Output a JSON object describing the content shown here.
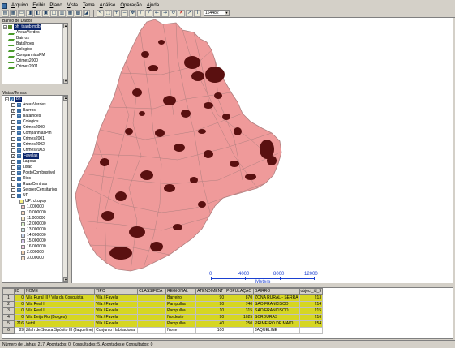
{
  "menu": {
    "items": [
      "Arquivo",
      "Exibir",
      "Plano",
      "Vista",
      "Tema",
      "Análise",
      "Operação",
      "Ajuda"
    ]
  },
  "toolbar": {
    "icons": [
      "open-database-icon",
      "open-layer-icon",
      "print-icon",
      "import-icon",
      "query-icon",
      "theme-icon",
      "layer-icon",
      "graph-icon",
      "table-icon",
      "grid-icon",
      "info-icon"
    ],
    "tools": [
      "pointer-icon",
      "zoom-area-icon",
      "zoom-in-icon",
      "zoom-out-icon",
      "pan-icon",
      "draw-icon",
      "ruler-icon",
      "arrow-left-icon",
      "arrow-right-icon",
      "refresh-icon",
      "delete-icon",
      "cursor-icon",
      "info-tool-icon"
    ],
    "scale_value": "164482"
  },
  "databases": {
    "title": "Banco de Dados",
    "root": "bh_tcaub.mdb",
    "layers": [
      "AreasVerdes",
      "Bairros",
      "Batalhoes",
      "Colegios",
      "CompanhiasPM",
      "Crimes2000",
      "Crimes2001"
    ]
  },
  "views": {
    "title": "Vistas/Temas",
    "root": "bh",
    "themes": [
      {
        "label": "AreasVerdes",
        "checked": false,
        "selected": false
      },
      {
        "label": "Bairros",
        "checked": true,
        "selected": false
      },
      {
        "label": "Batalhoes",
        "checked": false,
        "selected": false
      },
      {
        "label": "Colegios",
        "checked": false,
        "selected": false
      },
      {
        "label": "Crimes2000",
        "checked": false,
        "selected": false
      },
      {
        "label": "CompanhiasPm",
        "checked": false,
        "selected": false
      },
      {
        "label": "Crimes2001",
        "checked": false,
        "selected": false
      },
      {
        "label": "Crimes2002",
        "checked": false,
        "selected": false
      },
      {
        "label": "Crimes2003",
        "checked": false,
        "selected": false
      },
      {
        "label": "Favelas",
        "checked": true,
        "selected": true
      },
      {
        "label": "Lagoas",
        "checked": false,
        "selected": false
      },
      {
        "label": "Lixão",
        "checked": false,
        "selected": false
      },
      {
        "label": "PostoCombustivel",
        "checked": false,
        "selected": false
      },
      {
        "label": "Rios",
        "checked": false,
        "selected": false
      },
      {
        "label": "RuasCentrais",
        "checked": false,
        "selected": false
      },
      {
        "label": "SetoresCensitarios",
        "checked": false,
        "selected": false
      },
      {
        "label": "UP",
        "checked": false,
        "selected": false
      }
    ],
    "legend_title": "UP: ct.upop",
    "legend": [
      {
        "label": "1.000000",
        "color": "#f4c4c4"
      },
      {
        "label": "10.000000",
        "color": "#f8d8c0"
      },
      {
        "label": "11.000000",
        "color": "#fcecc8"
      },
      {
        "label": "12.000000",
        "color": "#d8f0c8"
      },
      {
        "label": "13.000000",
        "color": "#c8e8e8"
      },
      {
        "label": "14.000000",
        "color": "#c8d8f0"
      },
      {
        "label": "15.000000",
        "color": "#d8c8f0"
      },
      {
        "label": "16.000000",
        "color": "#f0c8e8"
      },
      {
        "label": "2.000000",
        "color": "#f0d0b0"
      },
      {
        "label": "3.000000",
        "color": "#f8e0c8"
      }
    ]
  },
  "map": {
    "fill_color": "#ef9a9a",
    "stroke_color": "#b08080",
    "favela_color": "#5a1010",
    "scale": {
      "ticks": [
        "0",
        "4000",
        "8000",
        "12000"
      ],
      "unit": "Meters",
      "color": "#1a3fd0"
    }
  },
  "table": {
    "columns": [
      "ID",
      "NOME",
      "TIPO",
      "CLASSIFICA",
      "REGIONAL",
      "ATENDIMENT",
      "POPULAÇÃO",
      "BAIRRO",
      "object_id_9"
    ],
    "rows": [
      {
        "num": "1",
        "cells": [
          "0",
          "Vila Rural III / Vila da Conquista",
          "Vila / Favela",
          "",
          "Barreiro",
          "90",
          "870",
          "ZONA RURAL - SERRA",
          "213"
        ],
        "hl": true
      },
      {
        "num": "2",
        "cells": [
          "0",
          "Vila Real II",
          "Vila / Favela",
          "",
          "Pampulha",
          "90",
          "740",
          "SAO FRANCISCO",
          "214"
        ],
        "hl": true
      },
      {
        "num": "3",
        "cells": [
          "0",
          "Vila Real I",
          "Vila / Favela",
          "",
          "Pampulha",
          "10",
          "315",
          "SAO FRANCISCO",
          "215"
        ],
        "hl": true
      },
      {
        "num": "4",
        "cells": [
          "0",
          "Vila Beija Flor(Borges)",
          "Vila / Favela",
          "",
          "Nordeste",
          "90",
          "1025",
          "SCRDURAS",
          "216"
        ],
        "hl": true
      },
      {
        "num": "5",
        "cells": [
          "216",
          "Vetril",
          "Vila / Favela",
          "",
          "Pampulha",
          "40",
          "250",
          "PRIMEIRO DE MAIO",
          "154"
        ],
        "hl": true
      },
      {
        "num": "6",
        "cells": [
          "89",
          "Zilah de Souza Spósito III (Jaqueline)",
          "Conjunto Habitacional",
          "",
          "Norte",
          "100",
          "",
          "JAQUELINE",
          ""
        ],
        "hl": false
      }
    ]
  },
  "status": "Número de Linhas: 217, Apontados: 0, Consultados: 5, Apontados e Consultados: 0"
}
